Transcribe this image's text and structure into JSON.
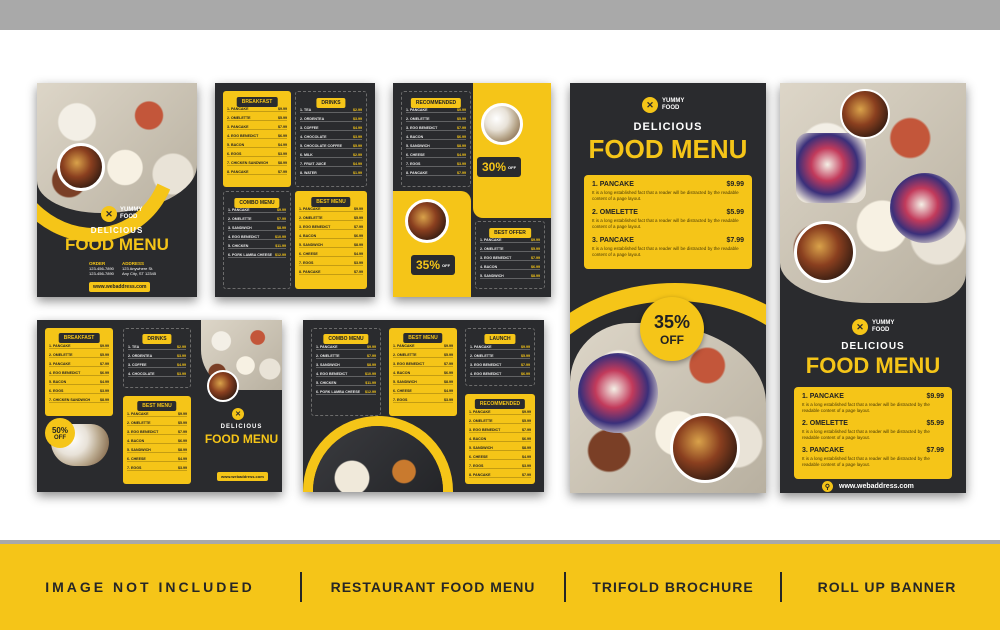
{
  "brand": {
    "logo_line1": "YUMMY",
    "logo_line2": "FOOD"
  },
  "headline": {
    "small": "DELICIOUS",
    "big": "FOOD MENU"
  },
  "web": "www.webaddress.com",
  "contact": {
    "order_label": "ORDER",
    "order_lines": [
      "123-456-7890",
      "123-456-7890"
    ],
    "address_label": "ADDRESS",
    "address_lines": [
      "123 Anywhere St.",
      "Any City, ST 12345"
    ]
  },
  "menu_sections": {
    "breakfast": {
      "label": "BREAKFAST",
      "items": [
        "1. PANCAKE",
        "2. OMELETTE",
        "3. PANCAKE",
        "4. EGG BENEDICT",
        "5. BACON",
        "6. EGGS",
        "7. CHICKEN SANDWICH",
        "8. PANCAKE"
      ],
      "prices": [
        "$9.99",
        "$5.99",
        "$7.99",
        "$6.99",
        "$4.99",
        "$3.99",
        "$8.99",
        "$7.99"
      ]
    },
    "drinks": {
      "label": "DRINKS",
      "items": [
        "1. TEA",
        "2. ORDENTEA",
        "3. COFFEE",
        "4. CHOCOLATE",
        "5. CHOCOLATE COFFEE",
        "6. MILK",
        "7. FRUIT JUICE",
        "8. WATER"
      ],
      "prices": [
        "$2.99",
        "$3.99",
        "$4.99",
        "$3.99",
        "$5.99",
        "$2.99",
        "$4.99",
        "$1.99"
      ]
    },
    "combo": {
      "label": "COMBO MENU",
      "items": [
        "1. PANCAKE",
        "2. OMELETTE",
        "3. SANDWICH",
        "4. EGG BENEDICT",
        "5. CHICKEN",
        "6. PORK LAMBA CHEESE"
      ],
      "prices": [
        "$9.99",
        "$7.99",
        "$8.99",
        "$10.99",
        "$11.99",
        "$12.99"
      ]
    },
    "best": {
      "label": "BEST MENU",
      "items": [
        "1. PANCAKE",
        "2. OMELETTE",
        "3. EGG BENEDICT",
        "4. BACON",
        "5. SANDWICH",
        "6. CHEESE",
        "7. EGGS",
        "8. PANCAKE"
      ],
      "prices": [
        "$9.99",
        "$5.99",
        "$7.99",
        "$6.99",
        "$8.99",
        "$4.99",
        "$3.99",
        "$7.99"
      ]
    },
    "recommended": {
      "label": "RECOMMENDED",
      "items": [
        "1. PANCAKE",
        "2. OMELETTE",
        "3. EGG BENEDICT",
        "4. BACON",
        "5. SANDWICH",
        "6. CHEESE",
        "7. EGGS",
        "8. PANCAKE"
      ],
      "prices": [
        "$9.99",
        "$5.99",
        "$7.99",
        "$6.99",
        "$8.99",
        "$4.99",
        "$3.99",
        "$7.99"
      ]
    },
    "best_offer": {
      "label": "BEST OFFER",
      "items": [
        "1. PANCAKE",
        "2. OMELETTE",
        "3. EGG BENEDICT",
        "4. BACON",
        "5. SANDWICH",
        "6. CHEESE",
        "7. EGGS",
        "8. WINE"
      ],
      "prices": [
        "$9.99",
        "$5.99",
        "$7.99",
        "$6.99",
        "$8.99",
        "$4.99",
        "$3.99",
        "$7.99"
      ]
    },
    "launch": {
      "label": "LAUNCH",
      "items": [
        "1. PANCAKE",
        "2. OMELETTE",
        "3. EGG BENEDICT",
        "4. EGG BENEDICT"
      ],
      "prices": [
        "$9.99",
        "$5.99",
        "$7.99",
        "$6.99"
      ]
    }
  },
  "offers": {
    "thirty": "30%",
    "thirty_off": "OFF",
    "thirtyfive": "35%",
    "thirtyfive_off": "OFF",
    "fifty": "50%",
    "fifty_off": "OFF"
  },
  "big_menu": [
    {
      "name": "1. PANCAKE",
      "price": "$9.99",
      "desc": "It is a long established fact that a reader will be distracted by the readable content of a page layout."
    },
    {
      "name": "2. OMELETTE",
      "price": "$5.99",
      "desc": "It is a long established fact that a reader will be distracted by the readable content of a page layout."
    },
    {
      "name": "3. PANCAKE",
      "price": "$7.99",
      "desc": "It is a long established fact that a reader will be distracted by the readable content of a page layout."
    }
  ],
  "bottom_bar": [
    "IMAGE NOT INCLUDED",
    "RESTAURANT FOOD MENU",
    "TRIFOLD BROCHURE",
    "ROLL UP BANNER"
  ],
  "colors": {
    "accent": "#f5c518",
    "panel": "#2a2b2e",
    "bar_text": "#262626"
  }
}
